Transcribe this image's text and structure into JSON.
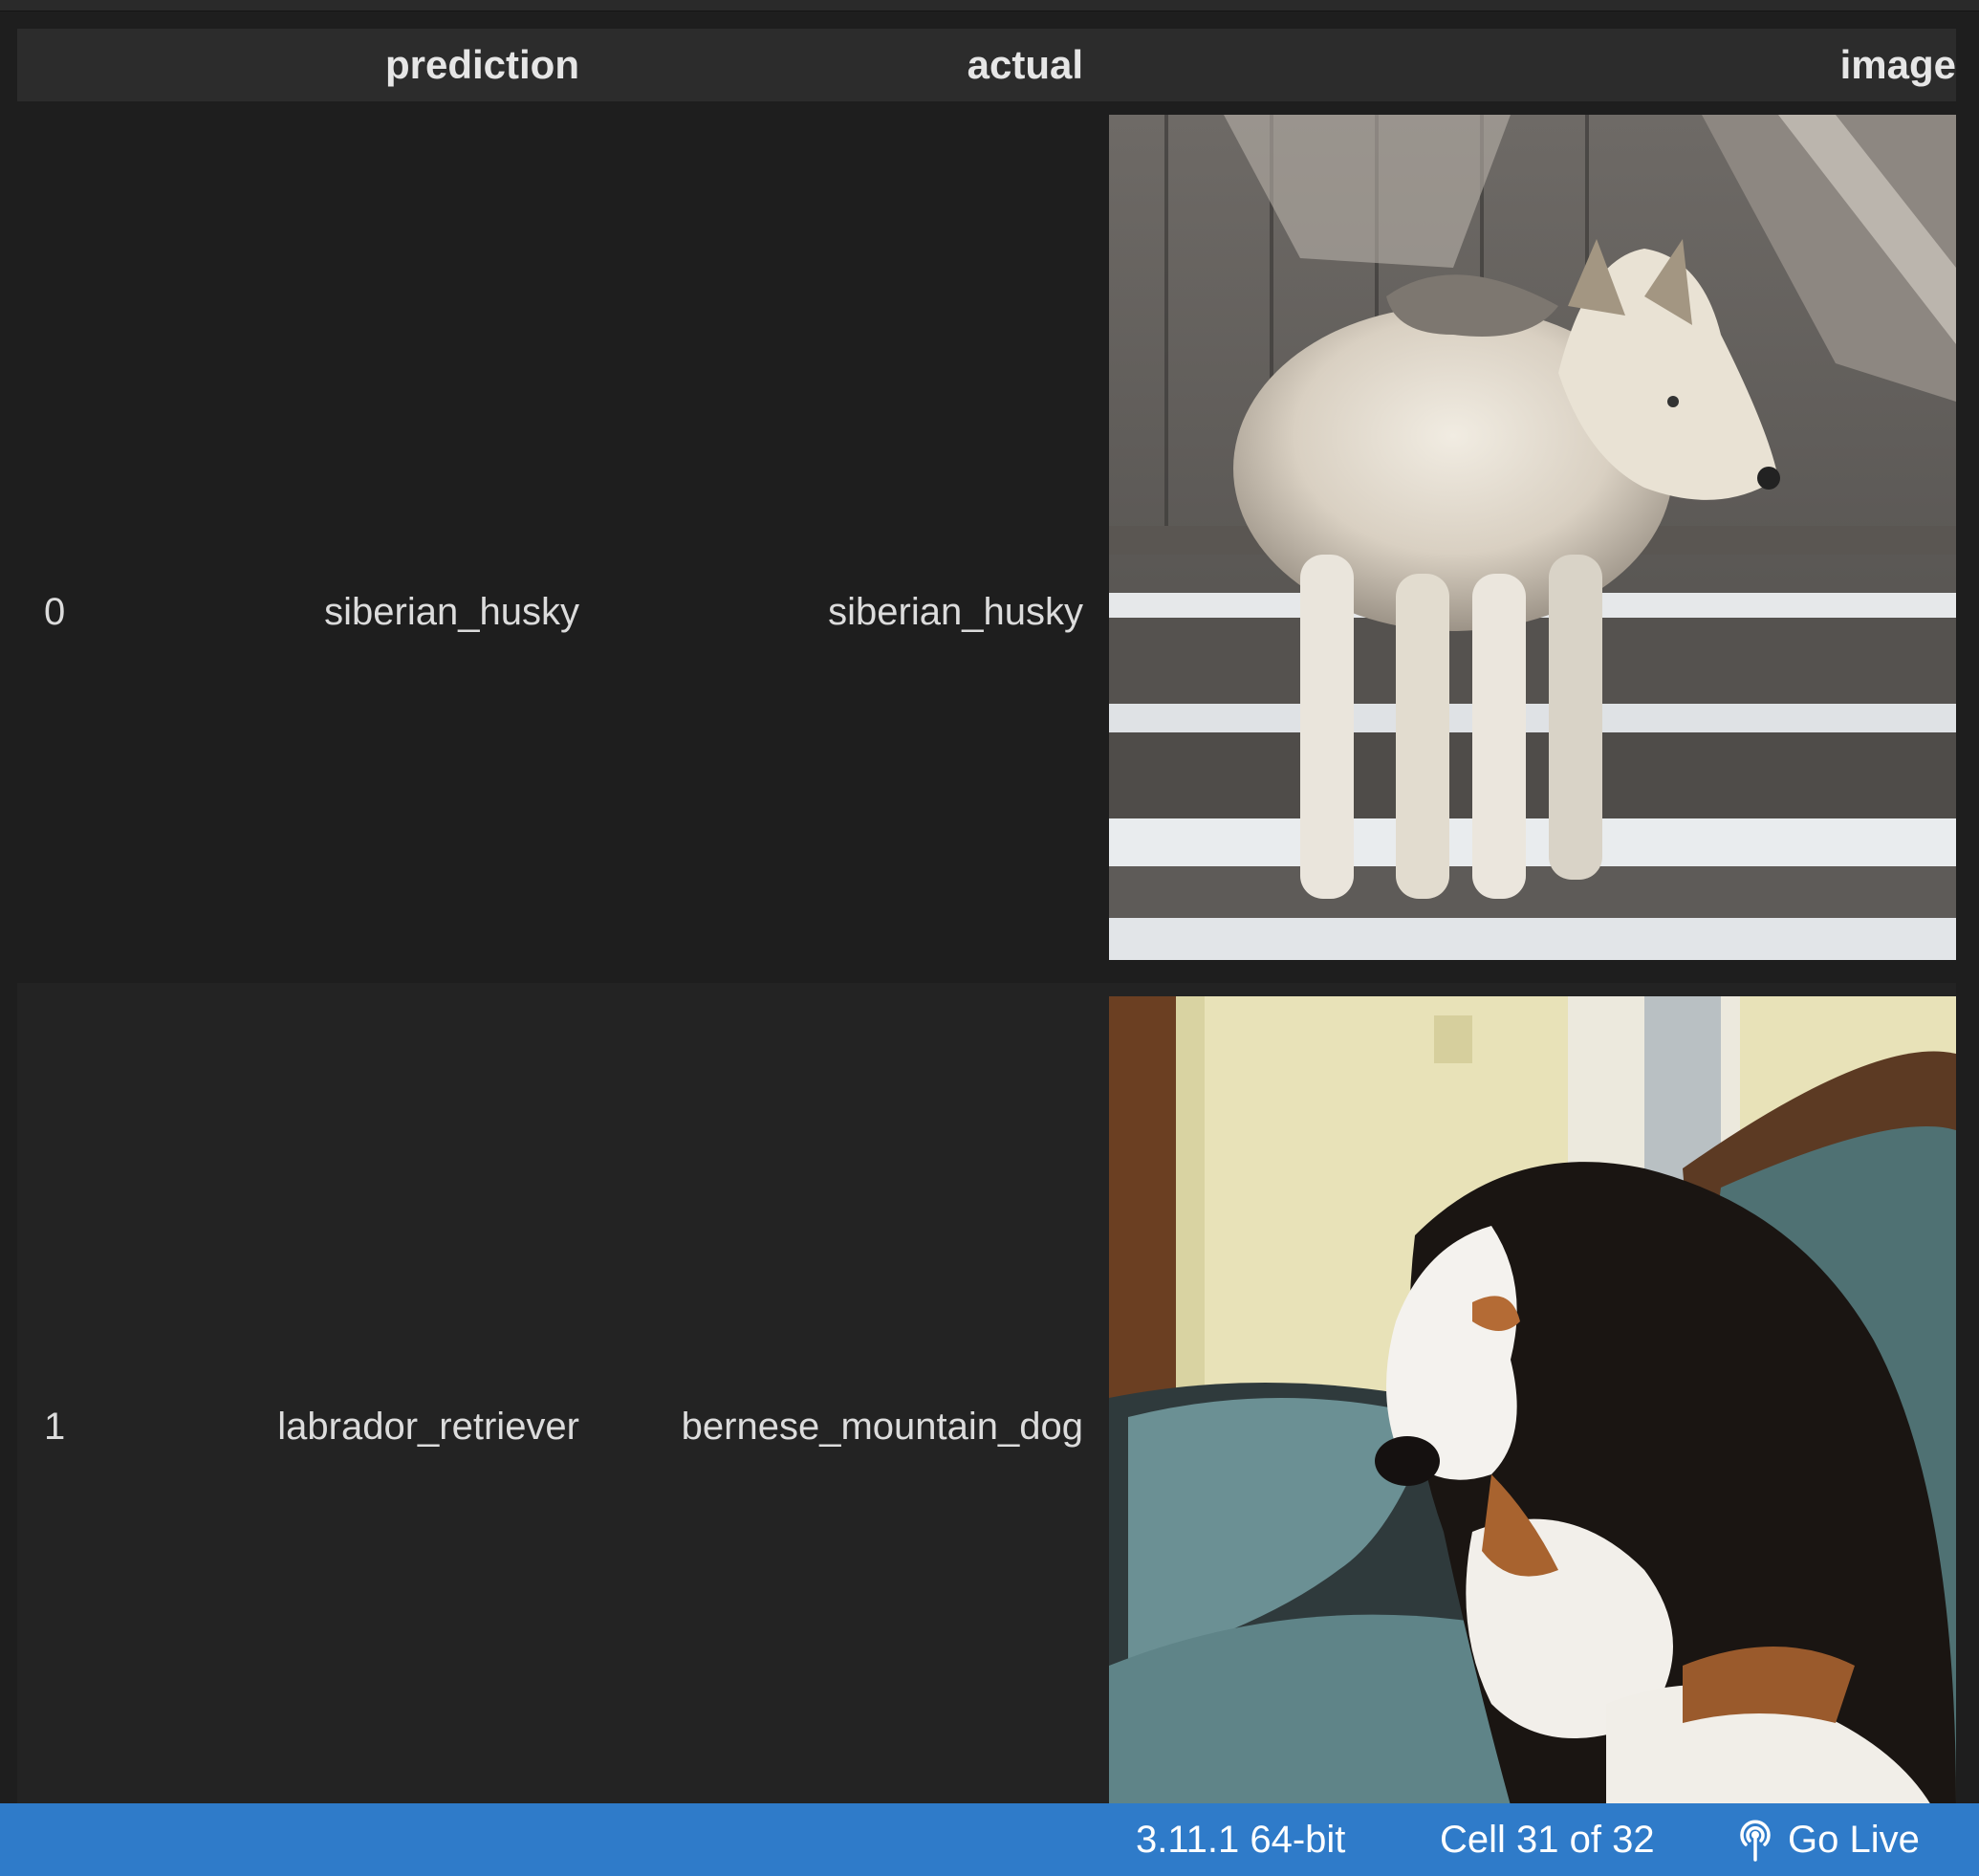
{
  "table": {
    "columns": [
      "prediction",
      "actual",
      "image"
    ],
    "rows": [
      {
        "index": "0",
        "prediction": "siberian_husky",
        "actual": "siberian_husky",
        "image": "husky dog on snowy wooden steps"
      },
      {
        "index": "1",
        "prediction": "labrador_retriever",
        "actual": "bernese_mountain_dog",
        "image": "bernese mountain dog puppy lying on a couch"
      }
    ]
  },
  "status_bar": {
    "python": "3.11.1 64-bit",
    "cell": "Cell 31 of 32",
    "go_live": "Go Live",
    "go_live_icon": "broadcast-icon",
    "color": "#2f7bc9"
  }
}
